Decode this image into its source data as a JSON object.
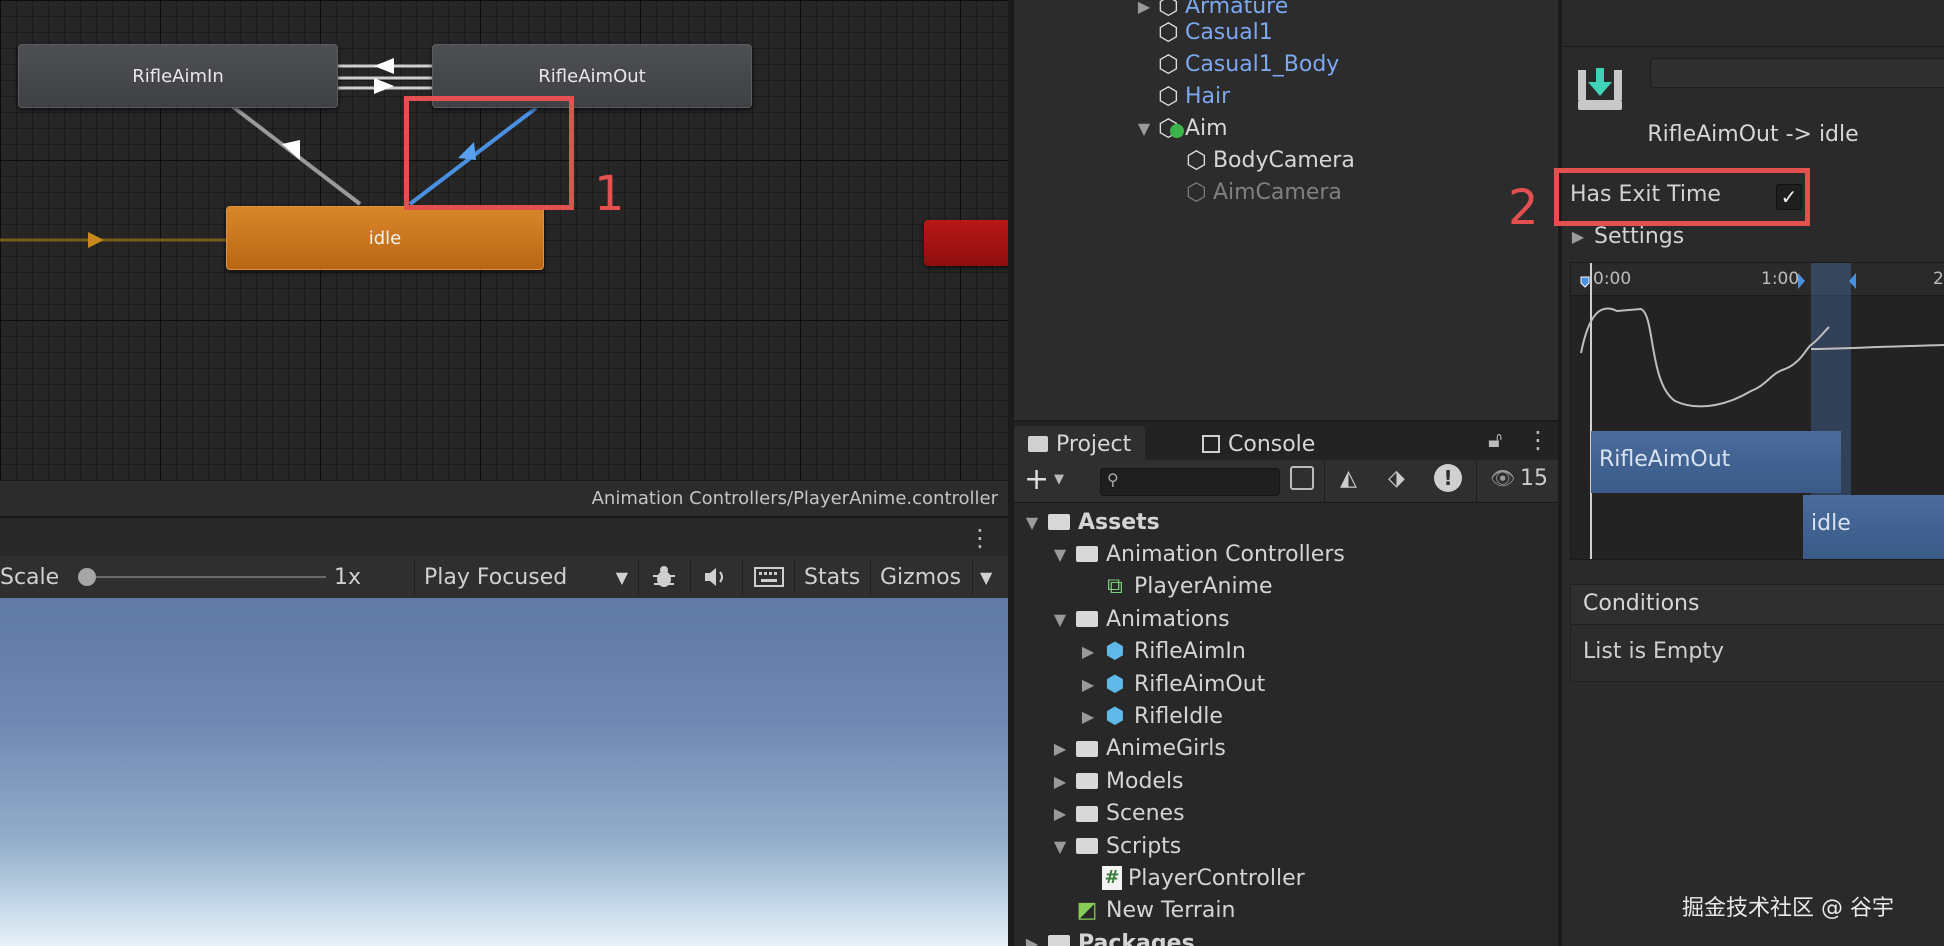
{
  "animator": {
    "states": [
      {
        "name": "RifleAimIn"
      },
      {
        "name": "RifleAimOut"
      },
      {
        "name": "idle"
      }
    ],
    "path": "Animation Controllers/PlayerAnime.controller"
  },
  "annotations": {
    "label_1": "1",
    "label_2": "2"
  },
  "game_toolbar": {
    "scale_label": "Scale",
    "scale_value": "1x",
    "scale_slider_fraction": 0.0,
    "play_mode": "Play Focused",
    "stats": "Stats",
    "gizmos": "Gizmos"
  },
  "hierarchy": {
    "items": [
      {
        "label": "Armature",
        "style": "prefab",
        "expandable": true
      },
      {
        "label": "Casual1",
        "style": "prefab"
      },
      {
        "label": "Casual1_Body",
        "style": "prefab"
      },
      {
        "label": "Hair",
        "style": "prefab"
      },
      {
        "label": "Aim",
        "style": "normal",
        "expanded": true
      },
      {
        "label": "BodyCamera",
        "style": "normal"
      },
      {
        "label": "AimCamera",
        "style": "disabled"
      }
    ]
  },
  "project": {
    "tabs": [
      "Project",
      "Console"
    ],
    "active_tab": "Project",
    "hidden_count": "15",
    "tree": [
      {
        "label": "Assets",
        "depth": 0,
        "bold": true,
        "expanded": true
      },
      {
        "label": "Animation Controllers",
        "depth": 1,
        "expanded": true
      },
      {
        "label": "PlayerAnime",
        "depth": 2
      },
      {
        "label": "Animations",
        "depth": 1,
        "expanded": true
      },
      {
        "label": "RifleAimIn",
        "depth": 2
      },
      {
        "label": "RifleAimOut",
        "depth": 2
      },
      {
        "label": "RifleIdle",
        "depth": 2
      },
      {
        "label": "AnimeGirls",
        "depth": 1
      },
      {
        "label": "Models",
        "depth": 1
      },
      {
        "label": "Scenes",
        "depth": 1
      },
      {
        "label": "Scripts",
        "depth": 1,
        "expanded": true
      },
      {
        "label": "PlayerController",
        "depth": 2
      },
      {
        "label": "New Terrain",
        "depth": 1
      },
      {
        "label": "Packages",
        "depth": 0,
        "bold": true
      }
    ]
  },
  "inspector": {
    "transition_title": "RifleAimOut -> idle",
    "has_exit_time_label": "Has Exit Time",
    "has_exit_time_checked": true,
    "settings_label": "Settings",
    "timeline": {
      "tick_start": "0:00",
      "tick_mid": "1:00",
      "tick_end": "2",
      "clip_from": "RifleAimOut",
      "clip_to": "idle"
    },
    "conditions_label": "Conditions",
    "conditions_empty": "List is Empty"
  },
  "watermark": "掘金技术社区 @ 谷宇",
  "colors": {
    "annotation_red": "#e35050",
    "state_orange": "#d07a20",
    "prefab_blue": "#7ca8f2",
    "selected_transition": "#4a90e2"
  }
}
